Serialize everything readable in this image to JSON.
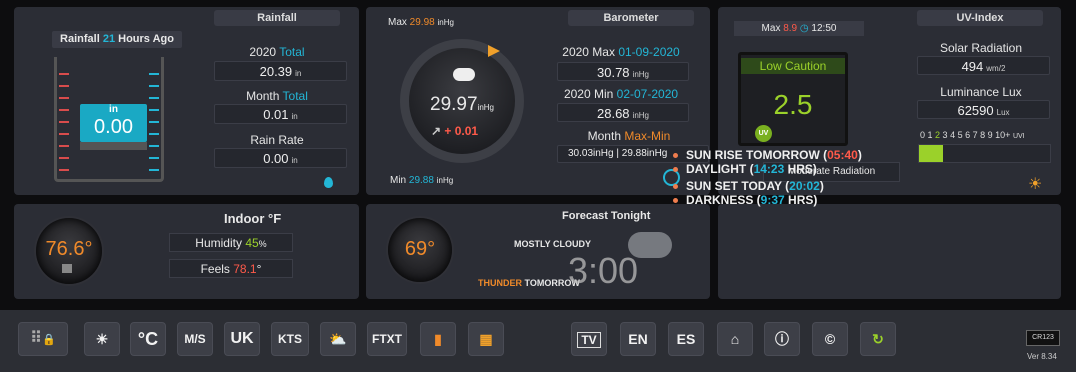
{
  "rain": {
    "tag": "Rainfall",
    "ago_pre": "Rainfall ",
    "ago_num": "21",
    "ago_post": " Hours Ago",
    "gauge_unit": "in",
    "gauge_value": "0.00",
    "total_pre": "2020 ",
    "total_post": "Total",
    "total_value": "20.39",
    "total_unit": "in",
    "month_pre": "Month ",
    "month_post": "Total",
    "month_value": "0.01",
    "month_unit": "in",
    "rate_label": "Rain Rate",
    "rate_value": "0.00",
    "rate_unit": "in"
  },
  "baro": {
    "tag": "Barometer",
    "max_pre": "Max ",
    "max_val": "29.98",
    "max_unit": "inHg",
    "min_pre": "Min ",
    "min_val": "29.88",
    "min_unit": "inHg",
    "current": "29.97",
    "current_unit": "inHg",
    "trend": "+ 0.01",
    "ymax_pre": "2020 Max ",
    "ymax_date": "01-09-2020",
    "ymax_value": "30.78",
    "ymax_unit": "inHg",
    "ymin_pre": "2020 Min ",
    "ymin_date": "02-07-2020",
    "ymin_value": "28.68",
    "ymin_unit": "inHg",
    "mm_pre": "Month ",
    "mm_post": "Max-Min",
    "mm_left": "30.03inHg",
    "mm_sep": "|",
    "mm_right": "29.88inHg"
  },
  "uv": {
    "tag": "UV-Index",
    "max_pre": "Max ",
    "max_val": "8.9",
    "time": "12:50",
    "caution": "Low Caution",
    "value": "2.5",
    "badge": "UV",
    "solar_label": "Solar Radiation",
    "solar_value": "494",
    "solar_unit": "wm/2",
    "lux_label": "Luminance Lux",
    "lux_value": "62590",
    "lux_unit": "Lux",
    "scale": [
      "0",
      "1",
      "2",
      "3",
      "4",
      "5",
      "6",
      "7",
      "8",
      "9",
      "10+"
    ],
    "scale_unit": "UVI",
    "level": 0.09,
    "moderate": "Moderate Radiation"
  },
  "indoor": {
    "tag": "Indoor °F",
    "temp": "76.6°",
    "hum_label": "Humidity ",
    "hum_value": "45",
    "hum_unit": "%",
    "feels_label": "Feels ",
    "feels_value": "78.1",
    "feels_unit": "°"
  },
  "forecast": {
    "title": "Forecast Tonight",
    "temp": "69°",
    "line1": "MOSTLY CLOUDY",
    "line2_a": "THUNDER",
    "line2_b": " TOMORROW",
    "clock": "3:00"
  },
  "sun": {
    "rise_pre": "SUN RISE TOMORROW (",
    "rise_time": "05:40",
    "rise_post": ")",
    "day_pre": "DAYLIGHT (",
    "day_time": "14:23",
    "day_post": " HRS)",
    "set_pre": "SUN SET TODAY (",
    "set_time": "20:02",
    "set_post": ")",
    "dark_pre": "DARKNESS (",
    "dark_time": "9:37",
    "dark_post": " HRS)"
  },
  "toolbar": {
    "celsius": "°C",
    "ms": "M/S",
    "uk": "UK",
    "kts": "KTS",
    "ftxt": "FTXT",
    "tv": "TV",
    "en": "EN",
    "es": "ES",
    "device": "CR123",
    "version": "Ver 8.34"
  },
  "colors": {
    "accent": "#23b6d6",
    "warm": "#f08a2a",
    "alert": "#ff5a4a",
    "green": "#9bd12a"
  }
}
